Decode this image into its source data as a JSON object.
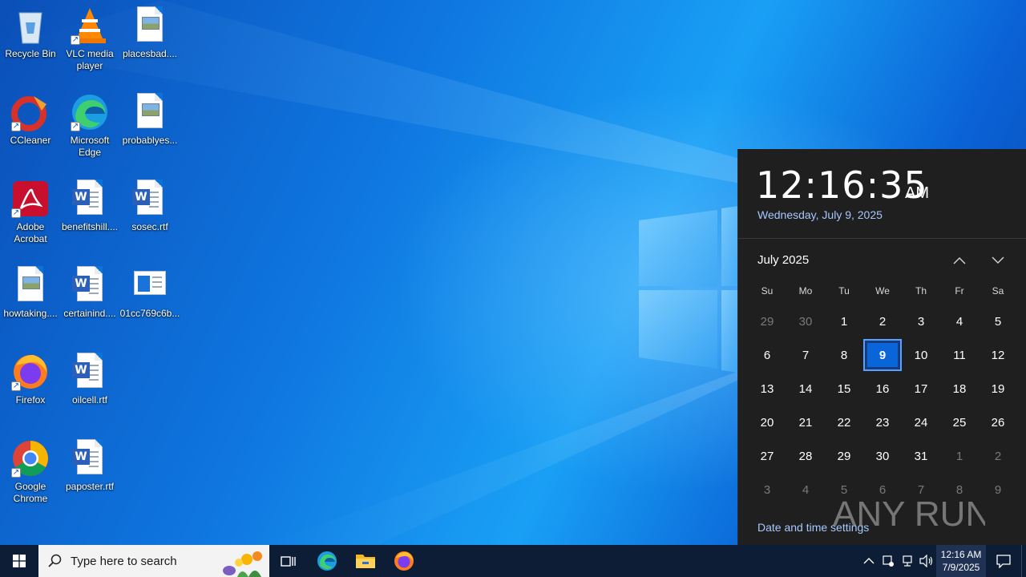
{
  "desktop": {
    "icons": [
      {
        "label": "Recycle Bin",
        "icon": "recycle-bin-icon"
      },
      {
        "label": "VLC media player",
        "icon": "vlc-icon"
      },
      {
        "label": "placesbad....",
        "icon": "image-file-icon"
      },
      {
        "label": "CCleaner",
        "icon": "ccleaner-icon"
      },
      {
        "label": "Microsoft Edge",
        "icon": "edge-icon"
      },
      {
        "label": "probablyes...",
        "icon": "image-file-icon"
      },
      {
        "label": "Adobe Acrobat",
        "icon": "acrobat-icon"
      },
      {
        "label": "benefitshill....",
        "icon": "word-document-icon"
      },
      {
        "label": "sosec.rtf",
        "icon": "word-document-icon"
      },
      {
        "label": "howtaking....",
        "icon": "image-file-icon"
      },
      {
        "label": "certainind....",
        "icon": "word-document-icon"
      },
      {
        "label": "01cc769c6b...",
        "icon": "app-window-icon"
      },
      {
        "label": "Firefox",
        "icon": "firefox-icon"
      },
      {
        "label": "oilcell.rtf",
        "icon": "word-document-icon"
      },
      {
        "label": "Google Chrome",
        "icon": "chrome-icon"
      },
      {
        "label": "paposter.rtf",
        "icon": "word-document-icon"
      }
    ]
  },
  "calendar": {
    "time": "12:16:35",
    "ampm": "AM",
    "date_long": "Wednesday, July 9, 2025",
    "month_title": "July 2025",
    "weekdays": [
      "Su",
      "Mo",
      "Tu",
      "We",
      "Th",
      "Fr",
      "Sa"
    ],
    "days": [
      [
        "29",
        "muted"
      ],
      [
        "30",
        "muted"
      ],
      [
        "1",
        ""
      ],
      [
        "2",
        ""
      ],
      [
        "3",
        ""
      ],
      [
        "4",
        ""
      ],
      [
        "5",
        ""
      ],
      [
        "6",
        ""
      ],
      [
        "7",
        ""
      ],
      [
        "8",
        ""
      ],
      [
        "9",
        "today"
      ],
      [
        "10",
        ""
      ],
      [
        "11",
        ""
      ],
      [
        "12",
        ""
      ],
      [
        "13",
        ""
      ],
      [
        "14",
        ""
      ],
      [
        "15",
        ""
      ],
      [
        "16",
        ""
      ],
      [
        "17",
        ""
      ],
      [
        "18",
        ""
      ],
      [
        "19",
        ""
      ],
      [
        "20",
        ""
      ],
      [
        "21",
        ""
      ],
      [
        "22",
        ""
      ],
      [
        "23",
        ""
      ],
      [
        "24",
        ""
      ],
      [
        "25",
        ""
      ],
      [
        "26",
        ""
      ],
      [
        "27",
        ""
      ],
      [
        "28",
        ""
      ],
      [
        "29",
        ""
      ],
      [
        "30",
        ""
      ],
      [
        "31",
        ""
      ],
      [
        "1",
        "muted"
      ],
      [
        "2",
        "muted"
      ],
      [
        "3",
        "muted"
      ],
      [
        "4",
        "muted"
      ],
      [
        "5",
        "muted"
      ],
      [
        "6",
        "muted"
      ],
      [
        "7",
        "muted"
      ],
      [
        "8",
        "muted"
      ],
      [
        "9",
        "muted"
      ]
    ],
    "settings_link": "Date and time settings",
    "watermark": "ANY RUN"
  },
  "taskbar": {
    "search_placeholder": "Type here to search",
    "pinned": [
      "task-view-icon",
      "edge-icon",
      "file-explorer-icon",
      "firefox-icon"
    ],
    "tray_time": "12:16 AM",
    "tray_date": "7/9/2025"
  },
  "colors": {
    "flyout_bg": "#1f1f1f",
    "accent": "#0a66d8",
    "link": "#a6c8ff",
    "taskbar_bg": "#0d1d35"
  }
}
